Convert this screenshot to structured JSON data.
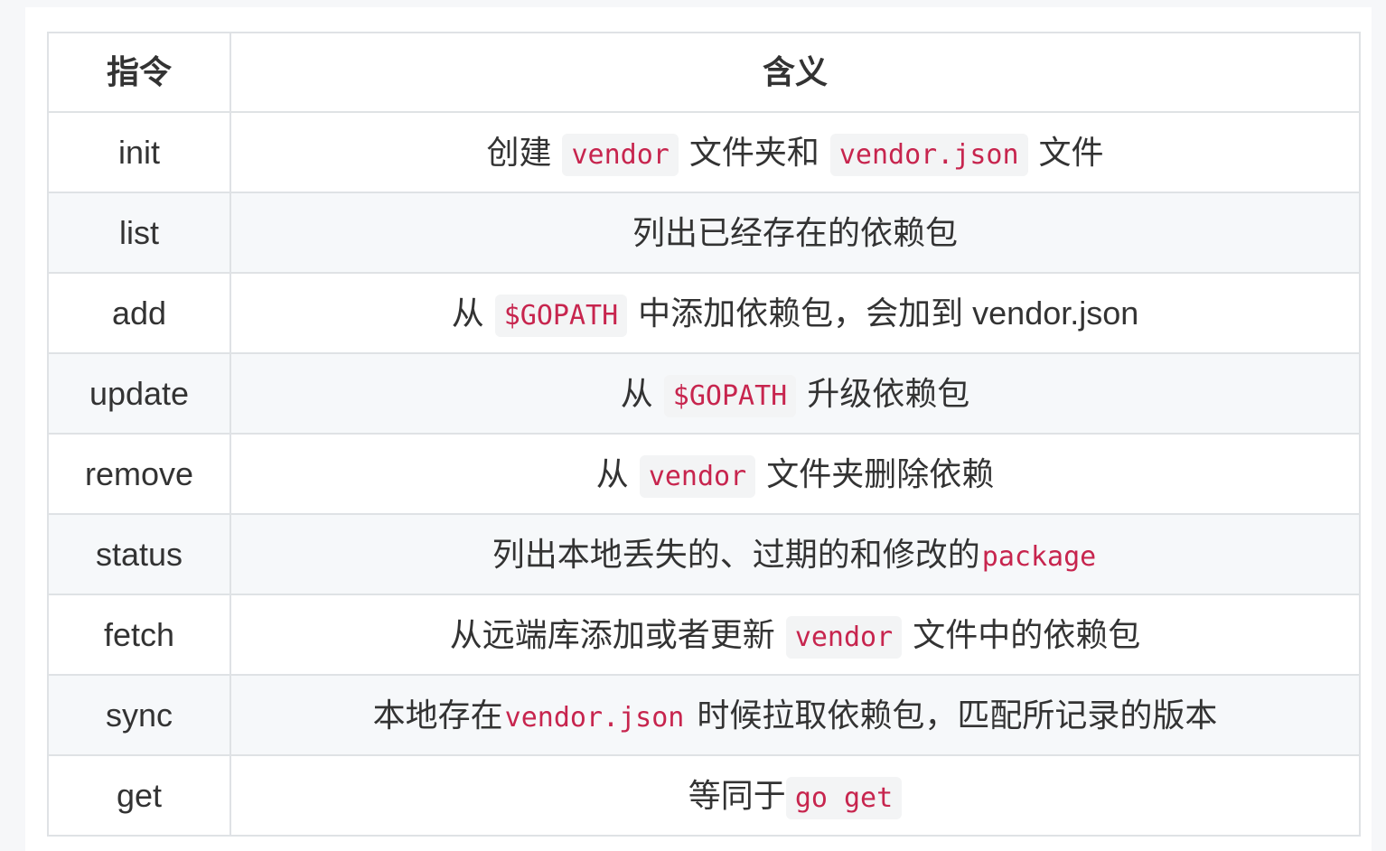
{
  "table": {
    "headers": [
      "指令",
      "含义"
    ],
    "rows": [
      {
        "command": "init",
        "parts": [
          {
            "t": "创建"
          },
          {
            "t": "vendor",
            "code": true
          },
          {
            "t": "文件夹和"
          },
          {
            "t": "vendor.json",
            "code": true
          },
          {
            "t": "文件"
          }
        ]
      },
      {
        "command": "list",
        "parts": [
          {
            "t": "列出已经存在的依赖包"
          }
        ]
      },
      {
        "command": "add",
        "parts": [
          {
            "t": "从"
          },
          {
            "t": "$GOPATH",
            "code": true
          },
          {
            "t": "中添加依赖包，会加到 vendor.json"
          }
        ]
      },
      {
        "command": "update",
        "parts": [
          {
            "t": "从"
          },
          {
            "t": "$GOPATH",
            "code": true
          },
          {
            "t": "升级依赖包"
          }
        ]
      },
      {
        "command": "remove",
        "parts": [
          {
            "t": "从"
          },
          {
            "t": "vendor",
            "code": true
          },
          {
            "t": "文件夹删除依赖"
          }
        ]
      },
      {
        "command": "status",
        "parts": [
          {
            "t": "列出本地丢失的、过期的和修改的"
          },
          {
            "t": "package",
            "code": true
          }
        ]
      },
      {
        "command": "fetch",
        "parts": [
          {
            "t": "从远端库添加或者更新"
          },
          {
            "t": "vendor",
            "code": true
          },
          {
            "t": "文件中的依赖包"
          }
        ]
      },
      {
        "command": "sync",
        "parts": [
          {
            "t": "本地存在"
          },
          {
            "t": "vendor.json",
            "code": true
          },
          {
            "t": "时候拉取依赖包，匹配所记录的版本"
          }
        ]
      },
      {
        "command": "get",
        "parts": [
          {
            "t": "等同于"
          },
          {
            "t": "go get",
            "code": true
          }
        ]
      }
    ]
  },
  "colors": {
    "code_text": "#c7254e",
    "code_bg": "#f3f4f5",
    "border": "#dfe2e5",
    "stripe": "#f6f8fa"
  }
}
